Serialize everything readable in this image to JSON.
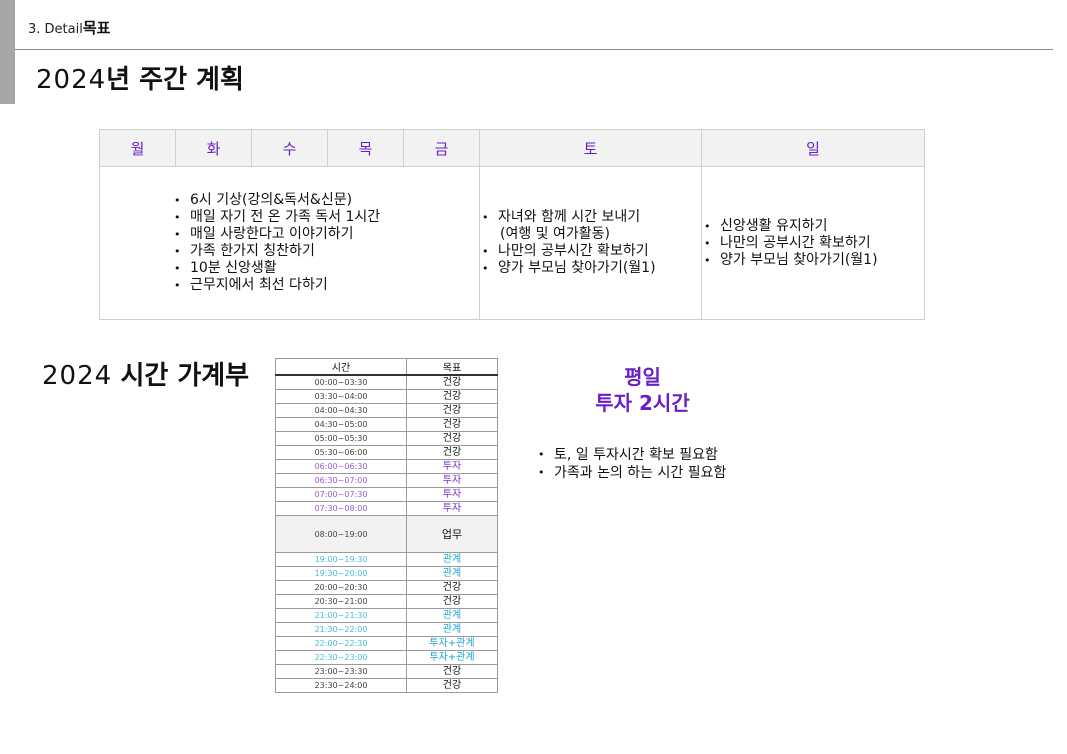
{
  "header": {
    "section_prefix": "3. Detail",
    "section_title": "목표"
  },
  "weekly_plan": {
    "year": "2024",
    "title": "년 주간 계획",
    "days": [
      "월",
      "화",
      "수",
      "목",
      "금",
      "토",
      "일"
    ],
    "weekday_items": [
      "6시 기상(강의&독서&신문)",
      "매일 자기 전 온 가족 독서 1시간",
      "매일 사랑한다고 이야기하기",
      "가족 한가지 칭찬하기",
      "10분 신앙생활",
      "근무지에서 최선 다하기"
    ],
    "saturday_items": [
      "자녀와 함께 시간 보내기",
      " (여행 및 여가활동)",
      "나만의 공부시간 확보하기",
      "양가 부모님 찾아가기(월1)"
    ],
    "sunday_items": [
      "신앙생활 유지하기",
      "나만의 공부시간 확보하기",
      "양가 부모님 찾아가기(월1)"
    ]
  },
  "time_ledger": {
    "year": "2024",
    "title": "시간 가계부",
    "headers": [
      "시간",
      "목표"
    ],
    "rows": [
      {
        "time": "00:00~03:30",
        "goal": "건강",
        "color": "dark"
      },
      {
        "time": "03:30~04:00",
        "goal": "건강",
        "color": "dark"
      },
      {
        "time": "04:00~04:30",
        "goal": "건강",
        "color": "dark"
      },
      {
        "time": "04:30~05:00",
        "goal": "건강",
        "color": "dark"
      },
      {
        "time": "05:00~05:30",
        "goal": "건강",
        "color": "dark"
      },
      {
        "time": "05:30~06:00",
        "goal": "건강",
        "color": "dark"
      },
      {
        "time": "06:00~06:30",
        "goal": "투자",
        "color": "purple"
      },
      {
        "time": "06:30~07:00",
        "goal": "투자",
        "color": "purple"
      },
      {
        "time": "07:00~07:30",
        "goal": "투자",
        "color": "purple"
      },
      {
        "time": "07:30~08:00",
        "goal": "투자",
        "color": "purple"
      },
      {
        "time": "08:00~19:00",
        "goal": "업무",
        "color": "dark",
        "tall": true
      },
      {
        "time": "19:00~19:30",
        "goal": "관계",
        "color": "blue"
      },
      {
        "time": "19:30~20:00",
        "goal": "관계",
        "color": "blue"
      },
      {
        "time": "20:00~20:30",
        "goal": "건강",
        "color": "dark"
      },
      {
        "time": "20:30~21:00",
        "goal": "건강",
        "color": "dark"
      },
      {
        "time": "21:00~21:30",
        "goal": "관계",
        "color": "blue"
      },
      {
        "time": "21:30~22:00",
        "goal": "관계",
        "color": "blue"
      },
      {
        "time": "22:00~22:30",
        "goal": "투자+관계",
        "color": "blue"
      },
      {
        "time": "22:30~23:00",
        "goal": "투자+관계",
        "color": "blue"
      },
      {
        "time": "23:00~23:30",
        "goal": "건강",
        "color": "dark"
      },
      {
        "time": "23:30~24:00",
        "goal": "건강",
        "color": "dark"
      }
    ],
    "weekday_heading_line1": "평일",
    "weekday_heading_line2": "투자 2시간",
    "notes": [
      "토, 일 투자시간 확보 필요함",
      "가족과 논의 하는 시간 필요함"
    ],
    "colors": {
      "purple": "#7b2fd0",
      "blue": "#1aa6d6",
      "header_purple": "#6a1fc7"
    }
  }
}
